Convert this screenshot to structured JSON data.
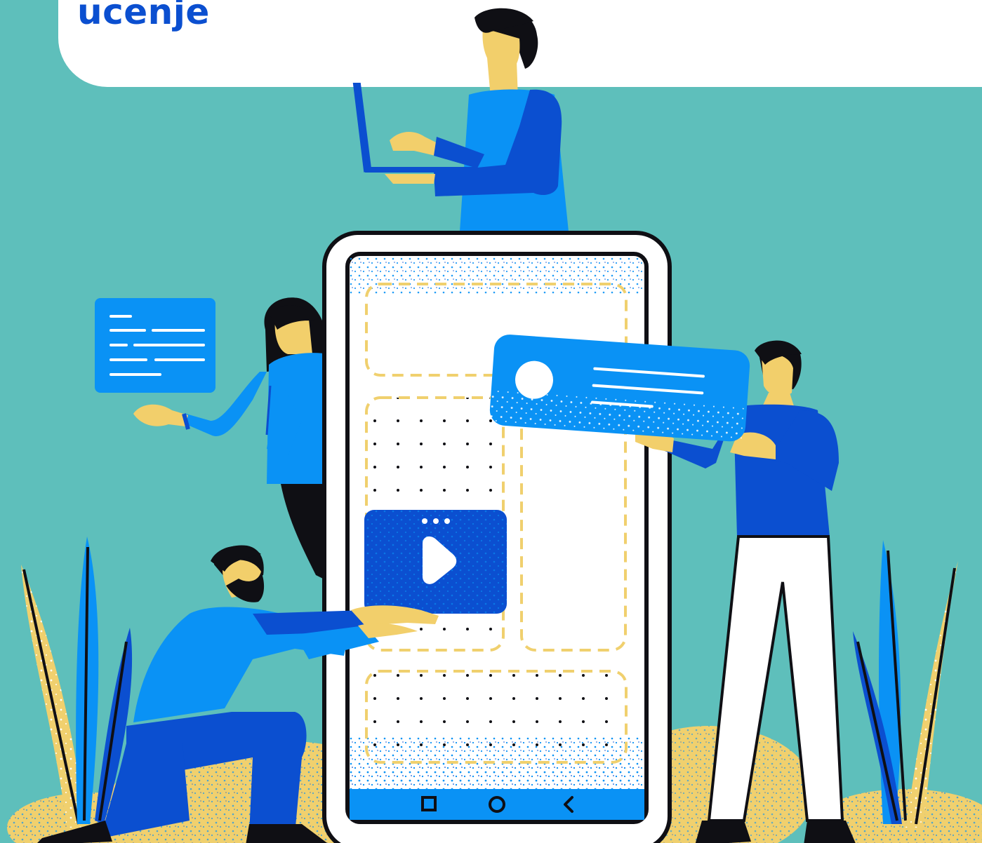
{
  "header": {
    "title": "ucenje"
  },
  "colors": {
    "background": "#5ebfbb",
    "dark_blue": "#0b4fd0",
    "light_blue": "#0a92f5",
    "skin": "#f2cf6b",
    "yellow": "#f0d06e",
    "black": "#0f0f14",
    "white": "#ffffff"
  },
  "phone": {
    "nav_icons": [
      "square-icon",
      "circle-icon",
      "back-chevron-icon"
    ]
  },
  "icons": {
    "play": "play-icon",
    "more": "three-dots-icon",
    "avatar": "avatar-circle-icon",
    "text_card": "text-lines-card-icon"
  }
}
